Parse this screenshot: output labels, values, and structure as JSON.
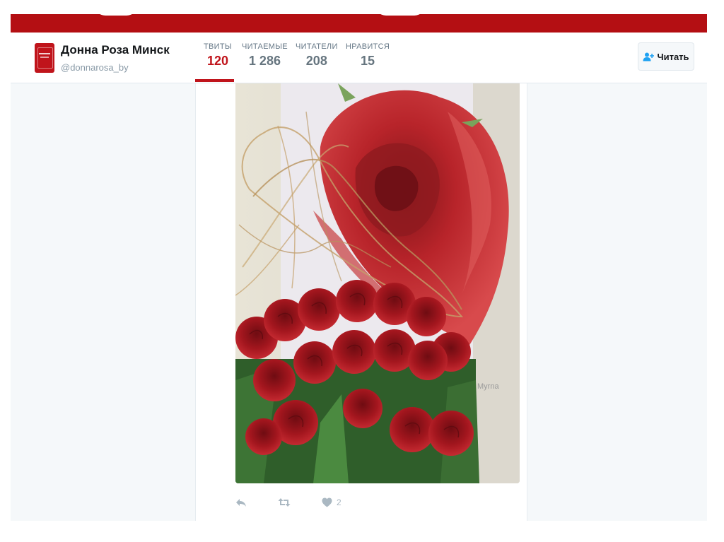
{
  "profile": {
    "name": "Донна Роза Минск",
    "handle": "@donnarosa_by"
  },
  "stats": [
    {
      "label": "ТВИТЫ",
      "value": "120",
      "active": true
    },
    {
      "label": "ЧИТАЕМЫЕ",
      "value": "1 286",
      "active": false
    },
    {
      "label": "ЧИТАТЕЛИ",
      "value": "208",
      "active": false
    },
    {
      "label": "НРАВИТСЯ",
      "value": "15",
      "active": false
    }
  ],
  "follow_button": {
    "label": "Читать",
    "icon": "person-plus-icon"
  },
  "tweet": {
    "photo_caption": "Myrna",
    "actions": {
      "reply_icon": "reply-icon",
      "retweet_icon": "retweet-icon",
      "like_icon": "heart-icon",
      "like_count": "2"
    }
  },
  "colors": {
    "brand": "#c0141b",
    "cover": "#b40f13",
    "muted": "#aab8c2"
  }
}
